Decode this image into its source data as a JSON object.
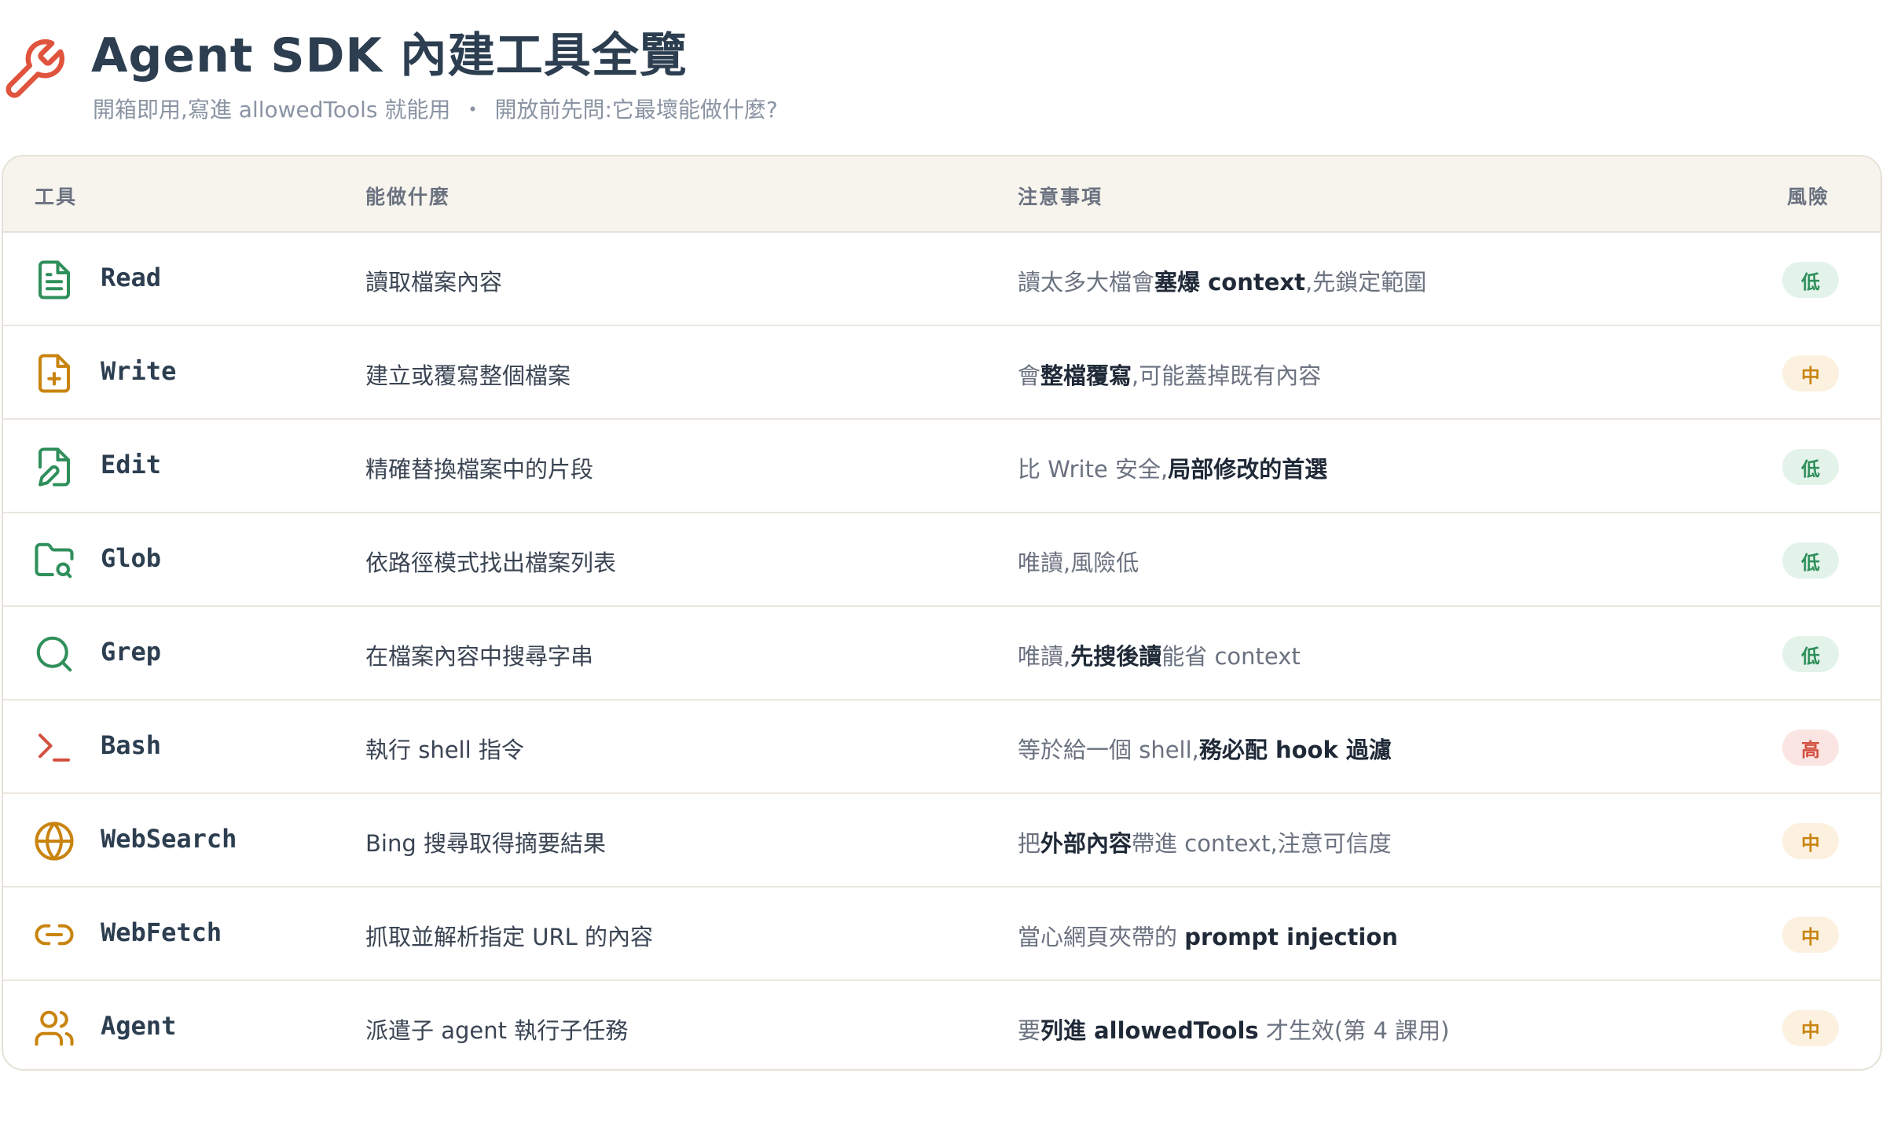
{
  "header": {
    "title": "Agent SDK 內建工具全覽",
    "subtitle_left": "開箱即用,寫進 allowedTools 就能用",
    "subtitle_sep": "・",
    "subtitle_right": "開放前先問:它最壞能做什麼?"
  },
  "table": {
    "columns": {
      "tool": "工具",
      "capability": "能做什麼",
      "notes": "注意事項",
      "risk": "風險"
    },
    "rows": [
      {
        "icon": "file-text-icon",
        "name": "Read",
        "capability": "讀取檔案內容",
        "note_parts": [
          "讀太多大檔會",
          "塞爆 context",
          ",先鎖定範圍"
        ],
        "risk": "低",
        "risk_level": "low"
      },
      {
        "icon": "file-plus-icon",
        "name": "Write",
        "capability": "建立或覆寫整個檔案",
        "note_parts": [
          "會",
          "整檔覆寫",
          ",可能蓋掉既有內容"
        ],
        "risk": "中",
        "risk_level": "medium"
      },
      {
        "icon": "file-pen-icon",
        "name": "Edit",
        "capability": "精確替換檔案中的片段",
        "note_parts": [
          "比 Write 安全,",
          "局部修改的首選",
          ""
        ],
        "risk": "低",
        "risk_level": "low"
      },
      {
        "icon": "folder-search-icon",
        "name": "Glob",
        "capability": "依路徑模式找出檔案列表",
        "note_parts": [
          "唯讀,風險低",
          "",
          ""
        ],
        "risk": "低",
        "risk_level": "low"
      },
      {
        "icon": "search-icon",
        "name": "Grep",
        "capability": "在檔案內容中搜尋字串",
        "note_parts": [
          "唯讀,",
          "先搜後讀",
          "能省 context"
        ],
        "risk": "低",
        "risk_level": "low"
      },
      {
        "icon": "terminal-icon",
        "name": "Bash",
        "capability": "執行 shell 指令",
        "note_parts": [
          "等於給一個 shell,",
          "務必配 hook 過濾",
          ""
        ],
        "risk": "高",
        "risk_level": "high"
      },
      {
        "icon": "globe-icon",
        "name": "WebSearch",
        "capability": "Bing 搜尋取得摘要結果",
        "note_parts": [
          "把",
          "外部內容",
          "帶進 context,注意可信度"
        ],
        "risk": "中",
        "risk_level": "medium"
      },
      {
        "icon": "link-icon",
        "name": "WebFetch",
        "capability": "抓取並解析指定 URL 的內容",
        "note_parts": [
          "當心網頁夾帶的 ",
          "prompt injection",
          ""
        ],
        "risk": "中",
        "risk_level": "medium"
      },
      {
        "icon": "users-icon",
        "name": "Agent",
        "capability": "派遣子 agent 執行子任務",
        "note_parts": [
          "要",
          "列進 allowedTools",
          " 才生效(第 4 課用)"
        ],
        "risk": "中",
        "risk_level": "medium"
      }
    ]
  },
  "colors": {
    "title": "#2c3e50",
    "wrench": "#e0533d",
    "green": "#2f8f5b",
    "amber": "#c98410",
    "red": "#d3503f",
    "header_bg": "#f7f4ee"
  }
}
